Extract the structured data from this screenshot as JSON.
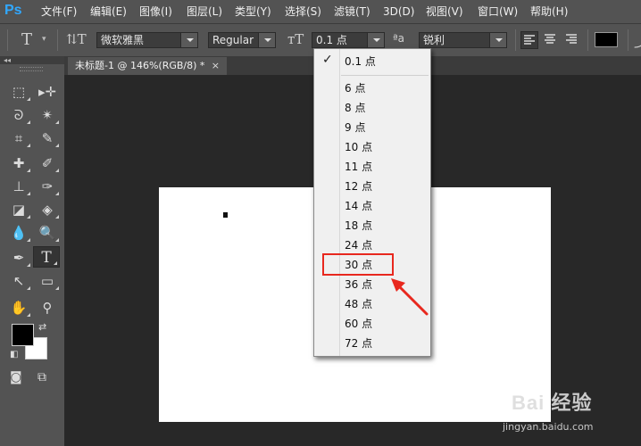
{
  "app": {
    "logo": "Ps"
  },
  "menu": [
    "文件(F)",
    "编辑(E)",
    "图像(I)",
    "图层(L)",
    "类型(Y)",
    "选择(S)",
    "滤镜(T)",
    "3D(D)",
    "视图(V)",
    "窗口(W)",
    "帮助(H)"
  ],
  "options": {
    "font_family": "微软雅黑",
    "font_style": "Regular",
    "font_size": "0.1 点",
    "antialias": "锐利",
    "text_color": "#000000"
  },
  "document": {
    "tab_title": "未标题-1 @ 146%(RGB/8) *"
  },
  "size_dropdown": {
    "selected": "0.1 点",
    "options": [
      "6 点",
      "8 点",
      "9 点",
      "10 点",
      "11 点",
      "12 点",
      "14 点",
      "18 点",
      "24 点",
      "30 点",
      "36 点",
      "48 点",
      "60 点",
      "72 点"
    ],
    "highlighted": "30 点"
  },
  "colors": {
    "foreground": "#000000",
    "background": "#ffffff",
    "highlight": "#e8281e",
    "accent": "#31a8ff"
  },
  "watermark": {
    "brand": "Bai 经验",
    "url": "jingyan.baidu.com"
  }
}
